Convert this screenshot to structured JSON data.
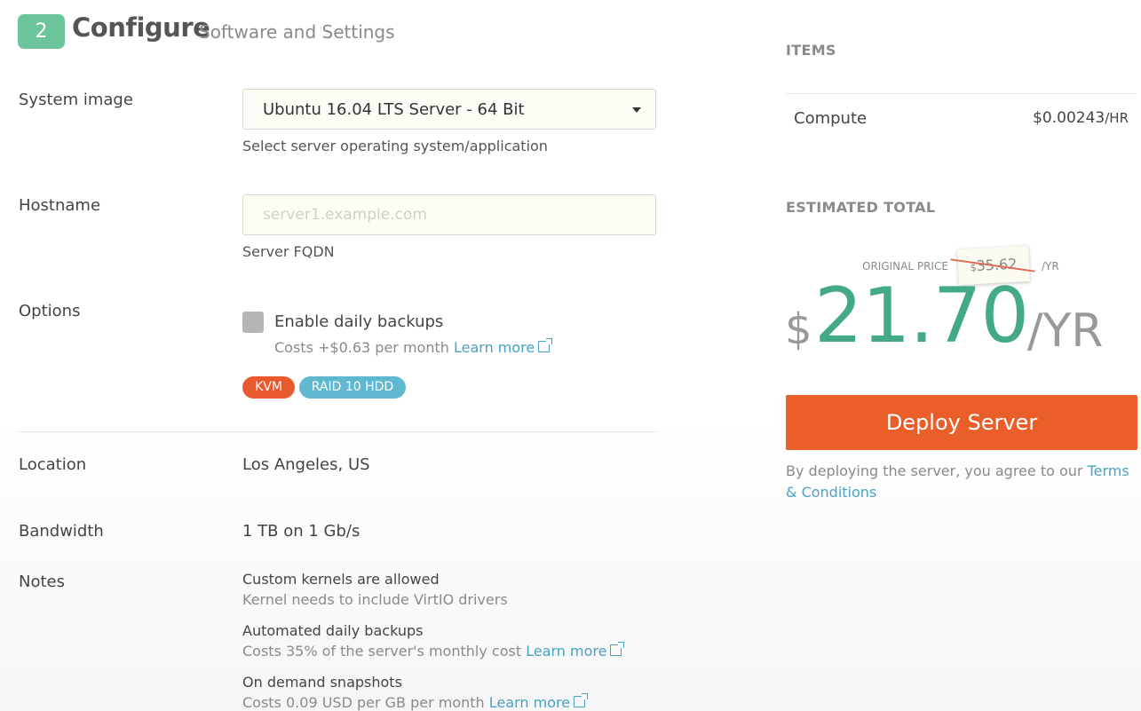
{
  "header": {
    "step": "2",
    "title": "Configure",
    "subtitle": "Software and Settings"
  },
  "system_image": {
    "label": "System image",
    "selected": "Ubuntu 16.04 LTS Server - 64 Bit",
    "help": "Select server operating system/application"
  },
  "hostname": {
    "label": "Hostname",
    "value": "",
    "placeholder": "server1.example.com",
    "help": "Server FQDN"
  },
  "options": {
    "label": "Options",
    "backup_label": "Enable daily backups",
    "backup_cost": "Costs +$0.63 per month",
    "learn_more": "Learn more",
    "checked": false,
    "badges": [
      {
        "text": "KVM",
        "color": "#e9592e"
      },
      {
        "text": "RAID 10 HDD",
        "color": "#5fb8cf"
      }
    ]
  },
  "location": {
    "label": "Location",
    "value": "Los Angeles, US"
  },
  "bandwidth": {
    "label": "Bandwidth",
    "value": "1 TB on 1 Gb/s"
  },
  "notes": {
    "label": "Notes",
    "items": [
      {
        "title": "Custom kernels are allowed",
        "desc": "Kernel needs to include VirtIO drivers",
        "link": ""
      },
      {
        "title": "Automated daily backups",
        "desc": "Costs 35% of the server's monthly cost",
        "link": "Learn more"
      },
      {
        "title": "On demand snapshots",
        "desc": "Costs 0.09 USD per GB per month",
        "link": "Learn more"
      }
    ]
  },
  "summary": {
    "items_heading": "ITEMS",
    "compute_label": "Compute",
    "compute_price": "$0.00243",
    "compute_unit": "/HR",
    "total_heading": "ESTIMATED TOTAL",
    "original_label": "ORIGINAL PRICE",
    "original_currency": "$",
    "original_price": "35.62",
    "original_unit": "/YR",
    "currency": "$",
    "price": "21.70",
    "unit": "/YR",
    "deploy_label": "Deploy Server",
    "terms_text": "By deploying the server, you agree to our ",
    "terms_link": "Terms & Conditions"
  },
  "colors": {
    "accent_green": "#44a985",
    "deploy_orange": "#ea5e29",
    "link_blue": "#49a2c4",
    "step_badge": "#6cc59a"
  }
}
